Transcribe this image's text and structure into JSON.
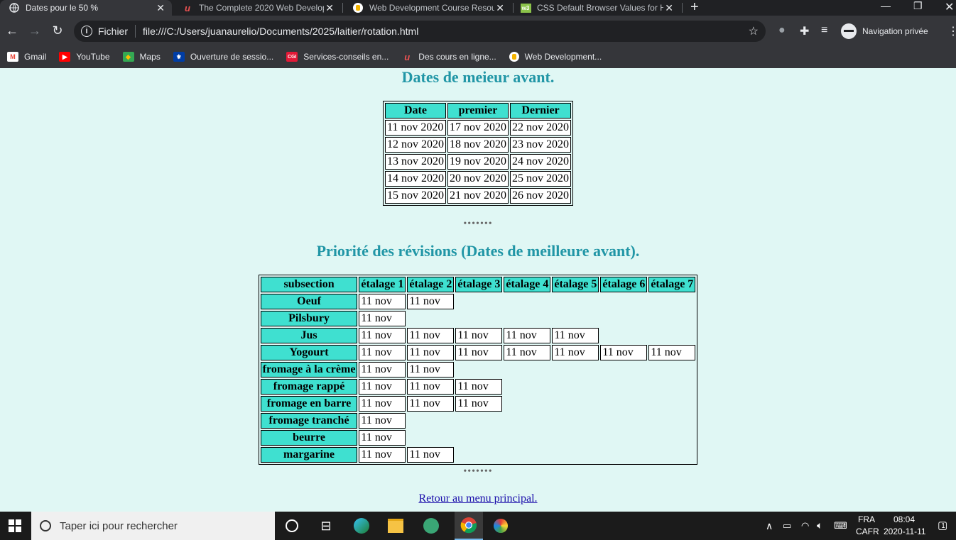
{
  "browser": {
    "tabs": [
      {
        "title": "Dates pour le 50 %",
        "icon": "globe-icon",
        "active": true
      },
      {
        "title": "The Complete 2020 Web Develop",
        "icon": "udemy-icon",
        "active": false
      },
      {
        "title": "Web Development Course Resou",
        "icon": "appbrewery-icon",
        "active": false
      },
      {
        "title": "CSS Default Browser Values for H",
        "icon": "w3-icon",
        "active": false
      }
    ],
    "address": {
      "scheme": "Fichier",
      "url": "file:///C:/Users/juanaurelio/Documents/2025/laitier/rotation.html"
    },
    "profile_label": "Navigation privée",
    "bookmarks": [
      {
        "label": "Gmail",
        "icon": "gmail-icon"
      },
      {
        "label": "YouTube",
        "icon": "youtube-icon"
      },
      {
        "label": "Maps",
        "icon": "maps-icon"
      },
      {
        "label": "Ouverture de sessio...",
        "icon": "quebec-icon"
      },
      {
        "label": "Services-conseils en...",
        "icon": "cgi-icon"
      },
      {
        "label": "Des cours en ligne...",
        "icon": "udemy-icon"
      },
      {
        "label": "Web Development...",
        "icon": "appbrewery-icon"
      }
    ]
  },
  "page": {
    "title1": "Dates de meieur avant.",
    "table1": {
      "headers": [
        "Date",
        "premier",
        "Dernier"
      ],
      "rows": [
        [
          "11 nov 2020",
          "17 nov 2020",
          "22 nov 2020"
        ],
        [
          "12 nov 2020",
          "18 nov 2020",
          "23 nov 2020"
        ],
        [
          "13 nov 2020",
          "19 nov 2020",
          "24 nov 2020"
        ],
        [
          "14 nov 2020",
          "20 nov 2020",
          "25 nov 2020"
        ],
        [
          "15 nov 2020",
          "21 nov 2020",
          "26 nov 2020"
        ]
      ]
    },
    "dots": "•••••••",
    "title2": "Priorité des révisions (Dates de meilleure avant).",
    "table2": {
      "headers": [
        "subsection",
        "étalage 1",
        "étalage 2",
        "étalage 3",
        "étalage 4",
        "étalage 5",
        "étalage 6",
        "étalage 7"
      ],
      "rows": [
        {
          "name": "Oeuf",
          "cells": [
            "11 nov",
            "11 nov"
          ]
        },
        {
          "name": "Pilsbury",
          "cells": [
            "11 nov"
          ]
        },
        {
          "name": "Jus",
          "cells": [
            "11 nov",
            "11 nov",
            "11 nov",
            "11 nov",
            "11 nov"
          ]
        },
        {
          "name": "Yogourt",
          "cells": [
            "11 nov",
            "11 nov",
            "11 nov",
            "11 nov",
            "11 nov",
            "11 nov",
            "11 nov"
          ]
        },
        {
          "name": "fromage à la crème",
          "cells": [
            "11 nov",
            "11 nov"
          ]
        },
        {
          "name": "fromage rappé",
          "cells": [
            "11 nov",
            "11 nov",
            "11 nov"
          ]
        },
        {
          "name": "fromage en barre",
          "cells": [
            "11 nov",
            "11 nov",
            "11 nov"
          ]
        },
        {
          "name": "fromage tranché",
          "cells": [
            "11 nov"
          ]
        },
        {
          "name": "beurre",
          "cells": [
            "11 nov"
          ]
        },
        {
          "name": "margarine",
          "cells": [
            "11 nov",
            "11 nov"
          ]
        }
      ]
    },
    "link": "Retour au menu principal."
  },
  "taskbar": {
    "search_placeholder": "Taper ici pour rechercher",
    "lang_top": "FRA",
    "lang_bottom": "CAFR",
    "time": "08:04",
    "date": "2020-11-11",
    "notifications": "1"
  }
}
